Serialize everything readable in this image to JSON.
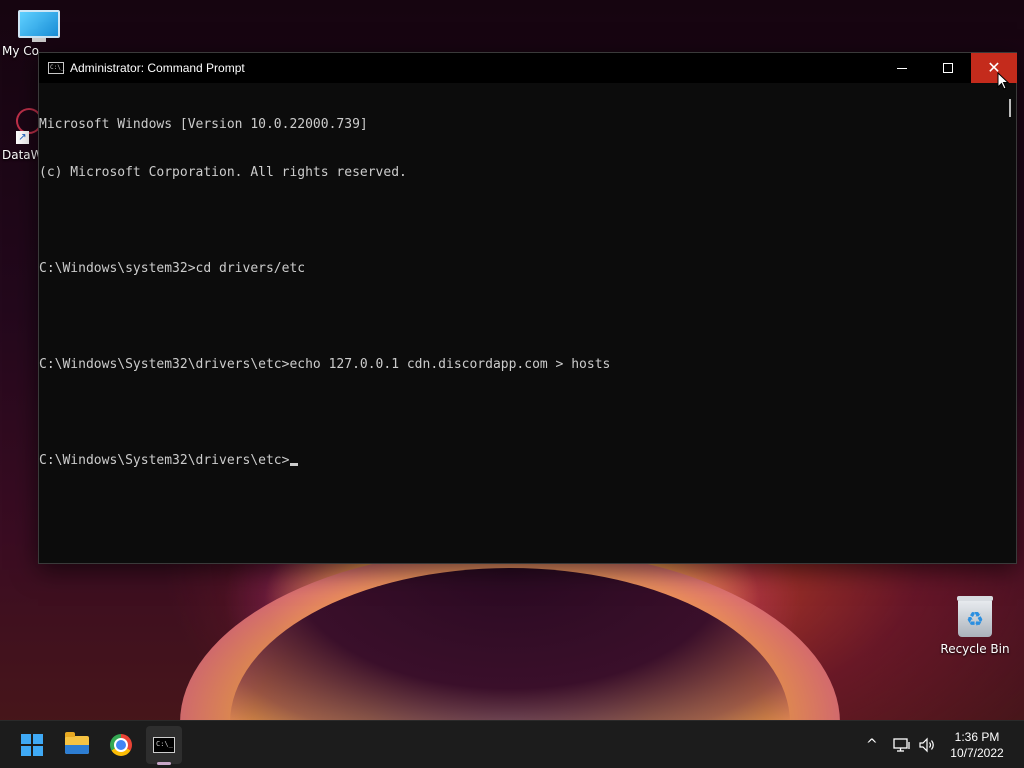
{
  "desktop": {
    "icons": [
      {
        "label": "My Co",
        "icon": "monitor-icon"
      },
      {
        "label": "DataW",
        "icon": "datawatch-icon"
      },
      {
        "label": "Recycle Bin",
        "icon": "recycle-bin-icon"
      }
    ]
  },
  "window": {
    "title": "Administrator: Command Prompt",
    "icon_text": "C:\\_",
    "controls": {
      "minimize": "minimize",
      "maximize": "maximize",
      "close": "close"
    }
  },
  "console": {
    "lines": [
      "Microsoft Windows [Version 10.0.22000.739]",
      "(c) Microsoft Corporation. All rights reserved.",
      "",
      "C:\\Windows\\system32>cd drivers/etc",
      "",
      "C:\\Windows\\System32\\drivers\\etc>echo 127.0.0.1 cdn.discordapp.com > hosts",
      "",
      "C:\\Windows\\System32\\drivers\\etc>"
    ]
  },
  "taskbar": {
    "apps": [
      {
        "name": "Start",
        "icon": "windows-start-icon"
      },
      {
        "name": "File Explorer",
        "icon": "folder-icon"
      },
      {
        "name": "Google Chrome",
        "icon": "chrome-icon"
      },
      {
        "name": "Command Prompt",
        "icon": "terminal-icon",
        "active": true
      }
    ],
    "tray": {
      "chevron": "^",
      "volume": "🔊"
    },
    "clock": {
      "time": "1:36 PM",
      "date": "10/7/2022"
    }
  },
  "colors": {
    "close_hover": "#c42b1c",
    "console_bg": "#0c0c0c",
    "console_fg": "#cccccc",
    "taskbar_bg": "#1c1c1c"
  }
}
